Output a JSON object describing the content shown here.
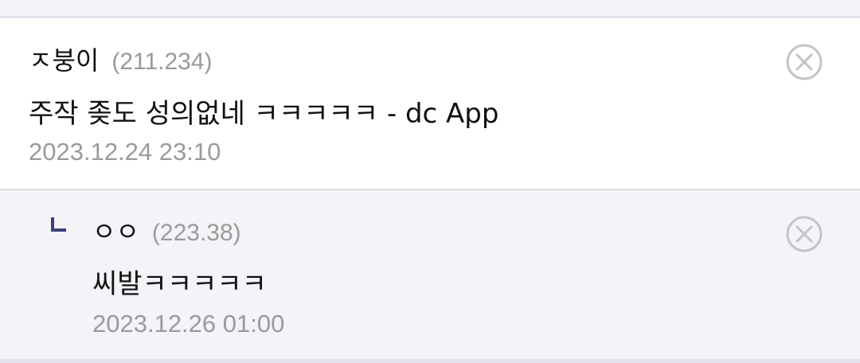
{
  "comments": [
    {
      "nickname": "ㅈ붕이",
      "ip": "(211.234)",
      "text": "주작 좆도 성의없네 ㅋㅋㅋㅋㅋ - dc App",
      "date": "2023.12.24 23:10",
      "delete_icon": "circle-x-icon"
    },
    {
      "reply_icon": "reply-corner-icon",
      "nickname": "ㅇㅇ",
      "ip": "(223.38)",
      "text": "씨발ㅋㅋㅋㅋㅋ",
      "date": "2023.12.26 01:00",
      "delete_icon": "circle-x-icon"
    }
  ],
  "colors": {
    "reply_bg": "#f3f3f8",
    "reply_icon": "#3b3f7a",
    "meta_text": "#9a9a9a",
    "icon_gray": "#c4c4c4"
  }
}
